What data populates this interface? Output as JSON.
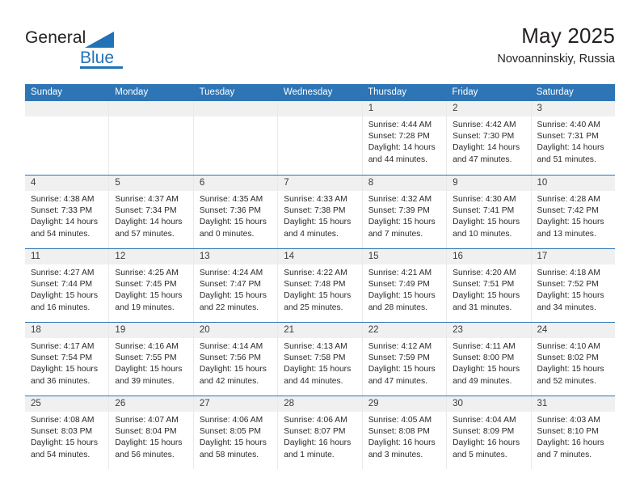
{
  "logo": {
    "word1": "General",
    "word2": "Blue",
    "accent_color": "#2272b6",
    "triangle_icon": "blue-triangle-icon"
  },
  "header": {
    "title": "May 2025",
    "subtitle": "Novoanninskiy, Russia"
  },
  "calendar": {
    "header_bg": "#2e75b6",
    "weekdays": [
      "Sunday",
      "Monday",
      "Tuesday",
      "Wednesday",
      "Thursday",
      "Friday",
      "Saturday"
    ],
    "weeks": [
      [
        {
          "day": "",
          "empty": true
        },
        {
          "day": "",
          "empty": true
        },
        {
          "day": "",
          "empty": true
        },
        {
          "day": "",
          "empty": true
        },
        {
          "day": "1",
          "sunrise": "Sunrise: 4:44 AM",
          "sunset": "Sunset: 7:28 PM",
          "daylight": "Daylight: 14 hours and 44 minutes."
        },
        {
          "day": "2",
          "sunrise": "Sunrise: 4:42 AM",
          "sunset": "Sunset: 7:30 PM",
          "daylight": "Daylight: 14 hours and 47 minutes."
        },
        {
          "day": "3",
          "sunrise": "Sunrise: 4:40 AM",
          "sunset": "Sunset: 7:31 PM",
          "daylight": "Daylight: 14 hours and 51 minutes."
        }
      ],
      [
        {
          "day": "4",
          "sunrise": "Sunrise: 4:38 AM",
          "sunset": "Sunset: 7:33 PM",
          "daylight": "Daylight: 14 hours and 54 minutes."
        },
        {
          "day": "5",
          "sunrise": "Sunrise: 4:37 AM",
          "sunset": "Sunset: 7:34 PM",
          "daylight": "Daylight: 14 hours and 57 minutes."
        },
        {
          "day": "6",
          "sunrise": "Sunrise: 4:35 AM",
          "sunset": "Sunset: 7:36 PM",
          "daylight": "Daylight: 15 hours and 0 minutes."
        },
        {
          "day": "7",
          "sunrise": "Sunrise: 4:33 AM",
          "sunset": "Sunset: 7:38 PM",
          "daylight": "Daylight: 15 hours and 4 minutes."
        },
        {
          "day": "8",
          "sunrise": "Sunrise: 4:32 AM",
          "sunset": "Sunset: 7:39 PM",
          "daylight": "Daylight: 15 hours and 7 minutes."
        },
        {
          "day": "9",
          "sunrise": "Sunrise: 4:30 AM",
          "sunset": "Sunset: 7:41 PM",
          "daylight": "Daylight: 15 hours and 10 minutes."
        },
        {
          "day": "10",
          "sunrise": "Sunrise: 4:28 AM",
          "sunset": "Sunset: 7:42 PM",
          "daylight": "Daylight: 15 hours and 13 minutes."
        }
      ],
      [
        {
          "day": "11",
          "sunrise": "Sunrise: 4:27 AM",
          "sunset": "Sunset: 7:44 PM",
          "daylight": "Daylight: 15 hours and 16 minutes."
        },
        {
          "day": "12",
          "sunrise": "Sunrise: 4:25 AM",
          "sunset": "Sunset: 7:45 PM",
          "daylight": "Daylight: 15 hours and 19 minutes."
        },
        {
          "day": "13",
          "sunrise": "Sunrise: 4:24 AM",
          "sunset": "Sunset: 7:47 PM",
          "daylight": "Daylight: 15 hours and 22 minutes."
        },
        {
          "day": "14",
          "sunrise": "Sunrise: 4:22 AM",
          "sunset": "Sunset: 7:48 PM",
          "daylight": "Daylight: 15 hours and 25 minutes."
        },
        {
          "day": "15",
          "sunrise": "Sunrise: 4:21 AM",
          "sunset": "Sunset: 7:49 PM",
          "daylight": "Daylight: 15 hours and 28 minutes."
        },
        {
          "day": "16",
          "sunrise": "Sunrise: 4:20 AM",
          "sunset": "Sunset: 7:51 PM",
          "daylight": "Daylight: 15 hours and 31 minutes."
        },
        {
          "day": "17",
          "sunrise": "Sunrise: 4:18 AM",
          "sunset": "Sunset: 7:52 PM",
          "daylight": "Daylight: 15 hours and 34 minutes."
        }
      ],
      [
        {
          "day": "18",
          "sunrise": "Sunrise: 4:17 AM",
          "sunset": "Sunset: 7:54 PM",
          "daylight": "Daylight: 15 hours and 36 minutes."
        },
        {
          "day": "19",
          "sunrise": "Sunrise: 4:16 AM",
          "sunset": "Sunset: 7:55 PM",
          "daylight": "Daylight: 15 hours and 39 minutes."
        },
        {
          "day": "20",
          "sunrise": "Sunrise: 4:14 AM",
          "sunset": "Sunset: 7:56 PM",
          "daylight": "Daylight: 15 hours and 42 minutes."
        },
        {
          "day": "21",
          "sunrise": "Sunrise: 4:13 AM",
          "sunset": "Sunset: 7:58 PM",
          "daylight": "Daylight: 15 hours and 44 minutes."
        },
        {
          "day": "22",
          "sunrise": "Sunrise: 4:12 AM",
          "sunset": "Sunset: 7:59 PM",
          "daylight": "Daylight: 15 hours and 47 minutes."
        },
        {
          "day": "23",
          "sunrise": "Sunrise: 4:11 AM",
          "sunset": "Sunset: 8:00 PM",
          "daylight": "Daylight: 15 hours and 49 minutes."
        },
        {
          "day": "24",
          "sunrise": "Sunrise: 4:10 AM",
          "sunset": "Sunset: 8:02 PM",
          "daylight": "Daylight: 15 hours and 52 minutes."
        }
      ],
      [
        {
          "day": "25",
          "sunrise": "Sunrise: 4:08 AM",
          "sunset": "Sunset: 8:03 PM",
          "daylight": "Daylight: 15 hours and 54 minutes."
        },
        {
          "day": "26",
          "sunrise": "Sunrise: 4:07 AM",
          "sunset": "Sunset: 8:04 PM",
          "daylight": "Daylight: 15 hours and 56 minutes."
        },
        {
          "day": "27",
          "sunrise": "Sunrise: 4:06 AM",
          "sunset": "Sunset: 8:05 PM",
          "daylight": "Daylight: 15 hours and 58 minutes."
        },
        {
          "day": "28",
          "sunrise": "Sunrise: 4:06 AM",
          "sunset": "Sunset: 8:07 PM",
          "daylight": "Daylight: 16 hours and 1 minute."
        },
        {
          "day": "29",
          "sunrise": "Sunrise: 4:05 AM",
          "sunset": "Sunset: 8:08 PM",
          "daylight": "Daylight: 16 hours and 3 minutes."
        },
        {
          "day": "30",
          "sunrise": "Sunrise: 4:04 AM",
          "sunset": "Sunset: 8:09 PM",
          "daylight": "Daylight: 16 hours and 5 minutes."
        },
        {
          "day": "31",
          "sunrise": "Sunrise: 4:03 AM",
          "sunset": "Sunset: 8:10 PM",
          "daylight": "Daylight: 16 hours and 7 minutes."
        }
      ]
    ]
  }
}
